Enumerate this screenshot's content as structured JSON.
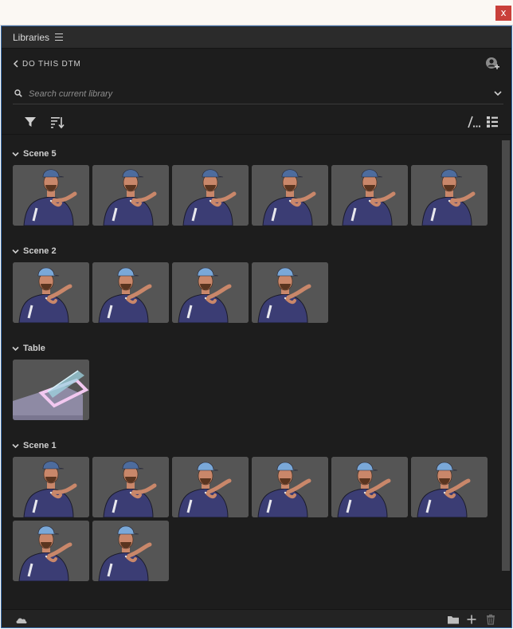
{
  "window": {
    "close_label": "x"
  },
  "panel": {
    "title": "Libraries"
  },
  "library": {
    "name": "DO THIS DTM"
  },
  "search": {
    "placeholder": "Search current library"
  },
  "groups": [
    {
      "title": "Scene 5",
      "items": [
        {
          "kind": "figure",
          "pose": "front",
          "hat": "cap-dark"
        },
        {
          "kind": "figure",
          "pose": "front",
          "hat": "cap-dark"
        },
        {
          "kind": "figure",
          "pose": "front",
          "hat": "cap-dark"
        },
        {
          "kind": "figure",
          "pose": "front",
          "hat": "cap-dark"
        },
        {
          "kind": "figure",
          "pose": "front",
          "hat": "cap-dark"
        },
        {
          "kind": "figure",
          "pose": "front",
          "hat": "cap-dark"
        }
      ]
    },
    {
      "title": "Scene 2",
      "items": [
        {
          "kind": "figure",
          "pose": "lean",
          "hat": "cap-light"
        },
        {
          "kind": "figure",
          "pose": "lean",
          "hat": "cap-light"
        },
        {
          "kind": "figure",
          "pose": "lean",
          "hat": "cap-light"
        },
        {
          "kind": "figure",
          "pose": "lean",
          "hat": "cap-light"
        }
      ]
    },
    {
      "title": "Table",
      "items": [
        {
          "kind": "table"
        }
      ]
    },
    {
      "title": "Scene 1",
      "items": [
        {
          "kind": "figure",
          "pose": "front",
          "hat": "cap-dark"
        },
        {
          "kind": "figure",
          "pose": "front",
          "hat": "cap-dark"
        },
        {
          "kind": "figure",
          "pose": "lean",
          "hat": "cap-light"
        },
        {
          "kind": "figure",
          "pose": "lean",
          "hat": "cap-light"
        },
        {
          "kind": "figure",
          "pose": "lean",
          "hat": "cap-light"
        },
        {
          "kind": "figure",
          "pose": "lean",
          "hat": "cap-light"
        },
        {
          "kind": "figure",
          "pose": "lean",
          "hat": "cap-light"
        },
        {
          "kind": "figure",
          "pose": "lean",
          "hat": "cap-light"
        }
      ]
    }
  ],
  "icons": {
    "panel_menu": "hamburger-icon",
    "back": "chevron-left-icon",
    "account": "add-user-icon",
    "search": "search-icon",
    "search_dropdown": "chevron-down-icon",
    "filter": "filter-icon",
    "sort": "sort-icon",
    "grid_view": "grid-view-icon",
    "list_view": "list-view-icon",
    "cloud": "cloud-icon",
    "folder": "folder-icon",
    "add": "add-icon",
    "trash": "trash-icon"
  },
  "colors": {
    "panel_bg": "#1d1d1d",
    "thumb_bg": "#555555",
    "shirt": "#3b3d74",
    "skin": "#c9876a",
    "cap_dark": "#4d6c9e",
    "cap_light": "#7aa8d8",
    "accent_border": "#3a6fb0",
    "close_red": "#c9403a"
  }
}
